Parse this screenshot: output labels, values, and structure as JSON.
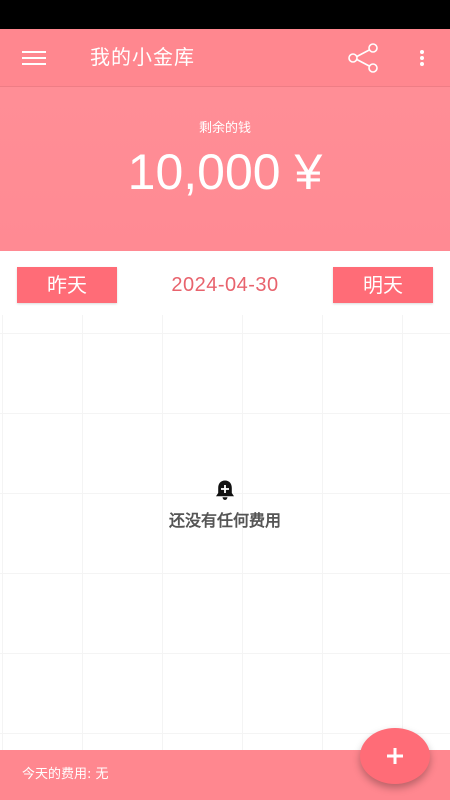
{
  "app_bar": {
    "title": "我的小金库",
    "icons": [
      "menu-icon",
      "share-icon",
      "more-vert-icon"
    ]
  },
  "balance": {
    "label": "剩余的钱",
    "amount": "10,000 ¥"
  },
  "date_nav": {
    "prev_label": "昨天",
    "current_date": "2024-04-30",
    "next_label": "明天"
  },
  "empty_state": {
    "icon": "bell-plus-icon",
    "message": "还没有任何费用"
  },
  "footer": {
    "today_expense": "今天的费用: 无"
  },
  "fab": {
    "icon": "plus-icon"
  },
  "colors": {
    "primary": "#ff878f",
    "accent": "#ff6c77",
    "date_text": "#e8636d",
    "status_bar": "#000000"
  }
}
